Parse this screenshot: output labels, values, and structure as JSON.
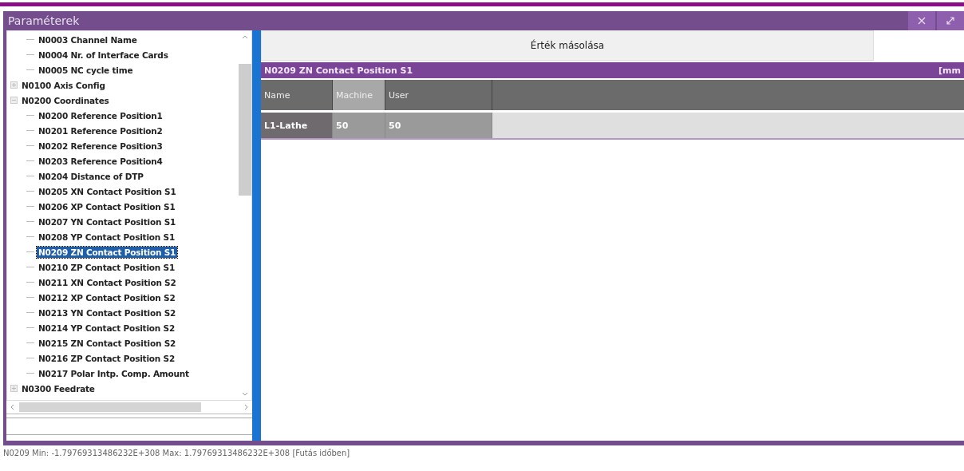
{
  "window": {
    "title": "Paraméterek"
  },
  "tree": [
    {
      "children": [
        {
          "label": "N0003 Channel Name",
          "selected": false
        },
        {
          "label": "N0004 Nr. of Interface Cards",
          "selected": false
        },
        {
          "label": "N0005 NC cycle time",
          "selected": false
        }
      ]
    },
    {
      "label": "N0100 Axis Config",
      "expanded": false,
      "selected": false
    },
    {
      "label": "N0200 Coordinates",
      "expanded": true,
      "selected": false,
      "children": [
        {
          "label": "N0200 Reference Position1",
          "selected": false
        },
        {
          "label": "N0201 Reference Position2",
          "selected": false
        },
        {
          "label": "N0202 Reference Position3",
          "selected": false
        },
        {
          "label": "N0203 Reference Position4",
          "selected": false
        },
        {
          "label": "N0204 Distance of DTP",
          "selected": false
        },
        {
          "label": "N0205 XN Contact Position S1",
          "selected": false
        },
        {
          "label": "N0206 XP Contact Position S1",
          "selected": false
        },
        {
          "label": "N0207 YN Contact Position S1",
          "selected": false
        },
        {
          "label": "N0208 YP Contact Position S1",
          "selected": false
        },
        {
          "label": "N0209 ZN Contact Position S1",
          "selected": true
        },
        {
          "label": "N0210 ZP Contact Position S1",
          "selected": false
        },
        {
          "label": "N0211 XN Contact Position S2",
          "selected": false
        },
        {
          "label": "N0212 XP Contact Position S2",
          "selected": false
        },
        {
          "label": "N0213 YN Contact Position S2",
          "selected": false
        },
        {
          "label": "N0214 YP Contact Position S2",
          "selected": false
        },
        {
          "label": "N0215 ZN Contact Position S2",
          "selected": false
        },
        {
          "label": "N0216 ZP Contact Position S2",
          "selected": false
        },
        {
          "label": "N0217 Polar Intp. Comp. Amount",
          "selected": false
        }
      ]
    },
    {
      "label": "N0300 Feedrate",
      "expanded": false,
      "selected": false
    }
  ],
  "copy_button": {
    "label": "Érték másolása"
  },
  "parameter": {
    "title": "N0209 ZN Contact Position S1",
    "unit": "[mm"
  },
  "table": {
    "columns": [
      {
        "label": "Name",
        "selected": false
      },
      {
        "label": "Machine",
        "selected": true
      },
      {
        "label": "User",
        "selected": false
      }
    ],
    "rows": [
      {
        "cells": [
          "L1-Lathe",
          "50",
          "50"
        ]
      }
    ]
  },
  "status_bar": "N0209 Min: -1.79769313486232E+308 Max: 1.79769313486232E+308 [Futás időben]"
}
